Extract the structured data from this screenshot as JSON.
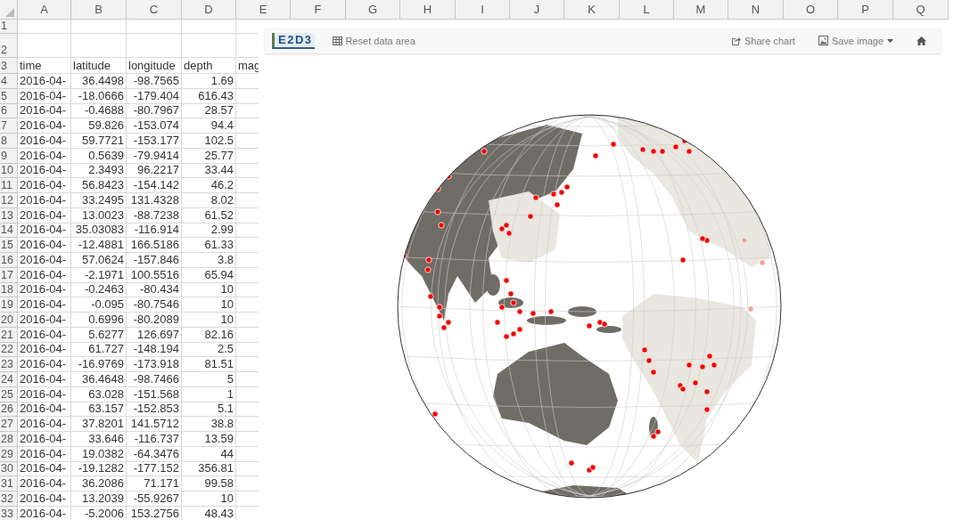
{
  "column_headers": [
    "A",
    "B",
    "C",
    "D",
    "E",
    "F",
    "G",
    "H",
    "I",
    "J",
    "K",
    "L",
    "M",
    "N",
    "O",
    "P",
    "Q"
  ],
  "row_numbers": [
    "1",
    "2",
    "3",
    "4",
    "5",
    "6",
    "7",
    "8",
    "9",
    "10",
    "11",
    "12",
    "13",
    "14",
    "15",
    "16",
    "17",
    "18",
    "19",
    "20",
    "21",
    "22",
    "23",
    "24",
    "25",
    "26",
    "27",
    "28",
    "29",
    "30",
    "31",
    "32",
    "33"
  ],
  "table": {
    "columns": [
      "time",
      "latitude",
      "longitude",
      "depth",
      "mag"
    ],
    "rows": [
      [
        "2016-04-",
        "36.4498",
        "-98.7565",
        "1.69"
      ],
      [
        "2016-04-",
        "-18.0666",
        "-179.404",
        "616.43"
      ],
      [
        "2016-04-",
        "-0.4688",
        "-80.7967",
        "28.57"
      ],
      [
        "2016-04-",
        "59.826",
        "-153.074",
        "94.4"
      ],
      [
        "2016-04-",
        "59.7721",
        "-153.177",
        "102.5"
      ],
      [
        "2016-04-",
        "0.5639",
        "-79.9414",
        "25.77"
      ],
      [
        "2016-04-",
        "2.3493",
        "96.2217",
        "33.44"
      ],
      [
        "2016-04-",
        "56.8423",
        "-154.142",
        "46.2"
      ],
      [
        "2016-04-",
        "33.2495",
        "131.4328",
        "8.02"
      ],
      [
        "2016-04-",
        "13.0023",
        "-88.7238",
        "61.52"
      ],
      [
        "2016-04-",
        "35.03083",
        "-116.914",
        "2.99"
      ],
      [
        "2016-04-",
        "-12.4881",
        "166.5186",
        "61.33"
      ],
      [
        "2016-04-",
        "57.0624",
        "-157.846",
        "3.8"
      ],
      [
        "2016-04-",
        "-2.1971",
        "100.5516",
        "65.94"
      ],
      [
        "2016-04-",
        "-0.2463",
        "-80.434",
        "10"
      ],
      [
        "2016-04-",
        "-0.095",
        "-80.7546",
        "10"
      ],
      [
        "2016-04-",
        "0.6996",
        "-80.2089",
        "10"
      ],
      [
        "2016-04-",
        "5.6277",
        "126.697",
        "82.16"
      ],
      [
        "2016-04-",
        "61.727",
        "-148.194",
        "2.5"
      ],
      [
        "2016-04-",
        "-16.9769",
        "-173.918",
        "81.51"
      ],
      [
        "2016-04-",
        "36.4648",
        "-98.7466",
        "5"
      ],
      [
        "2016-04-",
        "63.028",
        "-151.568",
        "1"
      ],
      [
        "2016-04-",
        "63.157",
        "-152.853",
        "5.1"
      ],
      [
        "2016-04-",
        "37.8201",
        "141.5712",
        "38.8"
      ],
      [
        "2016-04-",
        "33.646",
        "-116.737",
        "13.59"
      ],
      [
        "2016-04-",
        "19.0382",
        "-64.3476",
        "44"
      ],
      [
        "2016-04-",
        "-19.1282",
        "-177.152",
        "356.81"
      ],
      [
        "2016-04-",
        "36.2086",
        "71.171",
        "99.58"
      ],
      [
        "2016-04-",
        "13.2039",
        "-55.9267",
        "10"
      ],
      [
        "2016-04-",
        "-5.2006",
        "153.2756",
        "48.43"
      ]
    ]
  },
  "chart_toolbar": {
    "logo": "E2D3",
    "left_buttons": [
      {
        "label": "Reset data area",
        "dropdown": false
      }
    ],
    "right_buttons": [
      {
        "label": "Share chart",
        "dropdown": false
      },
      {
        "label": "Save image",
        "dropdown": true
      },
      {
        "dropdown": false
      }
    ]
  }
}
